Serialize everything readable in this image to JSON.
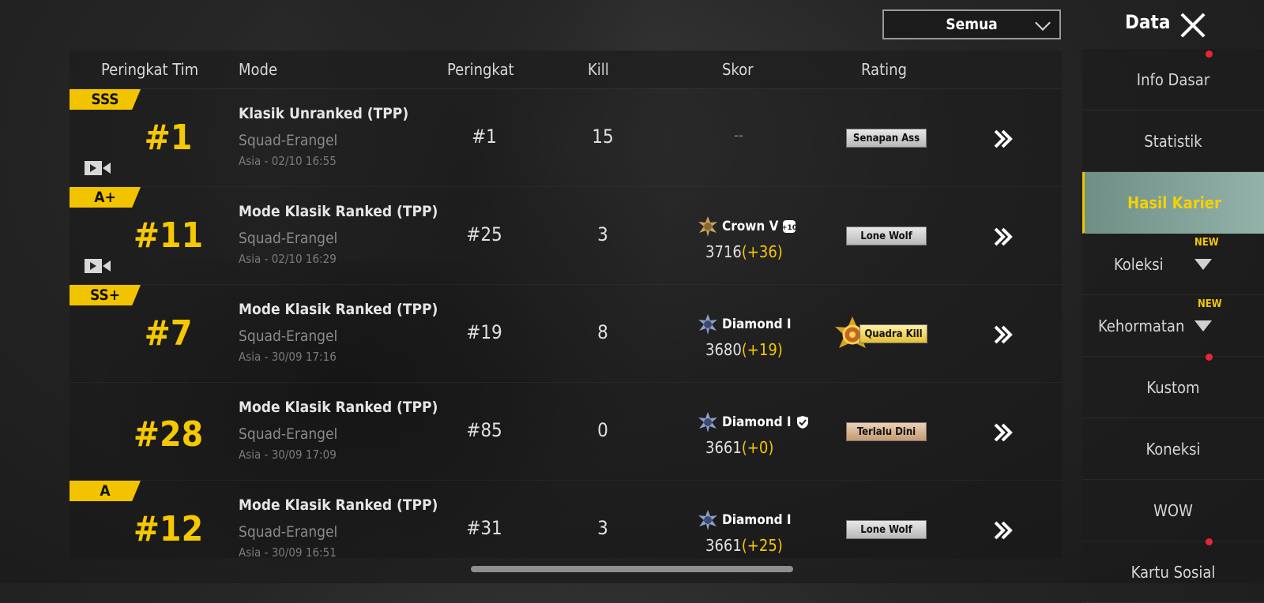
{
  "top": {
    "filter_value": "Semua",
    "panel_title": "Data"
  },
  "table": {
    "headers": {
      "team_rank": "Peringkat Tim",
      "mode": "Mode",
      "rank": "Peringkat",
      "kill": "Kill",
      "score": "Skor",
      "rating": "Rating"
    },
    "rows": [
      {
        "grade": "SSS",
        "team_rank": "#1",
        "has_replay": true,
        "mode_title": "Klasik Unranked (TPP)",
        "mode_sub": "Squad-Erangel",
        "mode_time": "Asia - 02/10 16:55",
        "rank": "#1",
        "kill": "15",
        "score_empty": "--",
        "rating": "Senapan Ass",
        "rating_style": "silver"
      },
      {
        "grade": "A+",
        "team_rank": "#11",
        "has_replay": true,
        "mode_title": "Mode Klasik Ranked (TPP)",
        "mode_sub": "Squad-Erangel",
        "mode_time": "Asia - 02/10 16:29",
        "rank": "#25",
        "kill": "3",
        "tier": "Crown V",
        "tier_extra": "+10",
        "score_base": "3716",
        "score_delta": "(+36)",
        "rating": "Lone Wolf",
        "rating_style": "silver"
      },
      {
        "grade": "SS+",
        "team_rank": "#7",
        "has_replay": false,
        "mode_title": "Mode Klasik Ranked (TPP)",
        "mode_sub": "Squad-Erangel",
        "mode_time": "Asia - 30/09 17:16",
        "rank": "#19",
        "kill": "8",
        "tier": "Diamond I",
        "score_base": "3680",
        "score_delta": "(+19)",
        "rating": "Quadra Kill",
        "rating_style": "gold"
      },
      {
        "grade": "",
        "team_rank": "#28",
        "has_replay": false,
        "mode_title": "Mode Klasik Ranked (TPP)",
        "mode_sub": "Squad-Erangel",
        "mode_time": "Asia - 30/09 17:09",
        "rank": "#85",
        "kill": "0",
        "tier": "Diamond I",
        "score_base": "3661",
        "score_delta": "(+0)",
        "rating": "Terlalu Dini",
        "rating_style": "bronze"
      },
      {
        "grade": "A",
        "team_rank": "#12",
        "has_replay": false,
        "mode_title": "Mode Klasik Ranked (TPP)",
        "mode_sub": "Squad-Erangel",
        "mode_time": "Asia - 30/09 16:51",
        "rank": "#31",
        "kill": "3",
        "tier": "Diamond I",
        "score_base": "3661",
        "score_delta": "(+25)",
        "rating": "Lone Wolf",
        "rating_style": "silver"
      }
    ]
  },
  "sidebar": {
    "items": [
      {
        "label": "Info Dasar"
      },
      {
        "label": "Statistik"
      },
      {
        "label": "Hasil Karier",
        "active": true
      },
      {
        "label": "Koleksi",
        "badge": "NEW"
      },
      {
        "label": "Kehormatan",
        "badge": "NEW"
      },
      {
        "label": "Kustom"
      },
      {
        "label": "Koneksi"
      },
      {
        "label": "WOW"
      },
      {
        "label": "Kartu Sosial"
      }
    ]
  },
  "colors": {
    "accent_yellow": "#f5c800",
    "notification_red": "#e8253a",
    "active_tab": "#80a097"
  }
}
